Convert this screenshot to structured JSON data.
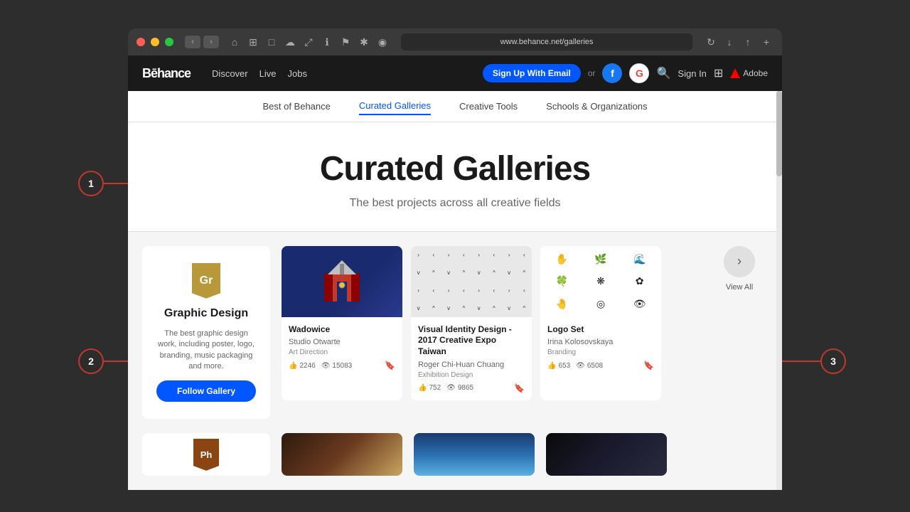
{
  "browser": {
    "url": "www.behance.net/galleries",
    "traffic_lights": [
      "red",
      "yellow",
      "green"
    ]
  },
  "nav": {
    "logo": "Bēhance",
    "links": [
      "Discover",
      "Live",
      "Jobs"
    ],
    "signup_btn": "Sign Up With Email",
    "or_text": "or",
    "sign_in": "Sign In",
    "adobe_text": "Adobe"
  },
  "sub_nav": {
    "links": [
      "Best of Behance",
      "Curated Galleries",
      "Creative Tools",
      "Schools & Organizations"
    ],
    "active": "Curated Galleries"
  },
  "hero": {
    "title": "Curated Galleries",
    "subtitle": "The best projects across all creative fields"
  },
  "gallery_graphic_design": {
    "badge_letter": "Gr",
    "name": "Graphic Design",
    "description": "The best graphic design work, including poster, logo, branding, music packaging and more.",
    "follow_btn": "Follow Gallery",
    "projects": [
      {
        "title": "Wadowice",
        "author": "Studio Otwarte",
        "category": "Art Direction",
        "likes": "2246",
        "views": "15083"
      },
      {
        "title": "Visual Identity Design - 2017 Creative Expo Taiwan",
        "author": "Roger Chi-Huan Chuang",
        "category": "Exhibition Design",
        "likes": "752",
        "views": "9865"
      },
      {
        "title": "Logo Set",
        "author": "Irina Kolosovskaya",
        "category": "Branding",
        "likes": "653",
        "views": "6508"
      }
    ],
    "view_all": "View All"
  },
  "annotations": [
    {
      "id": "1",
      "direction": "right"
    },
    {
      "id": "2",
      "direction": "right"
    },
    {
      "id": "3",
      "direction": "left"
    }
  ],
  "bottom_gallery": {
    "badge_letter": "Ph"
  }
}
